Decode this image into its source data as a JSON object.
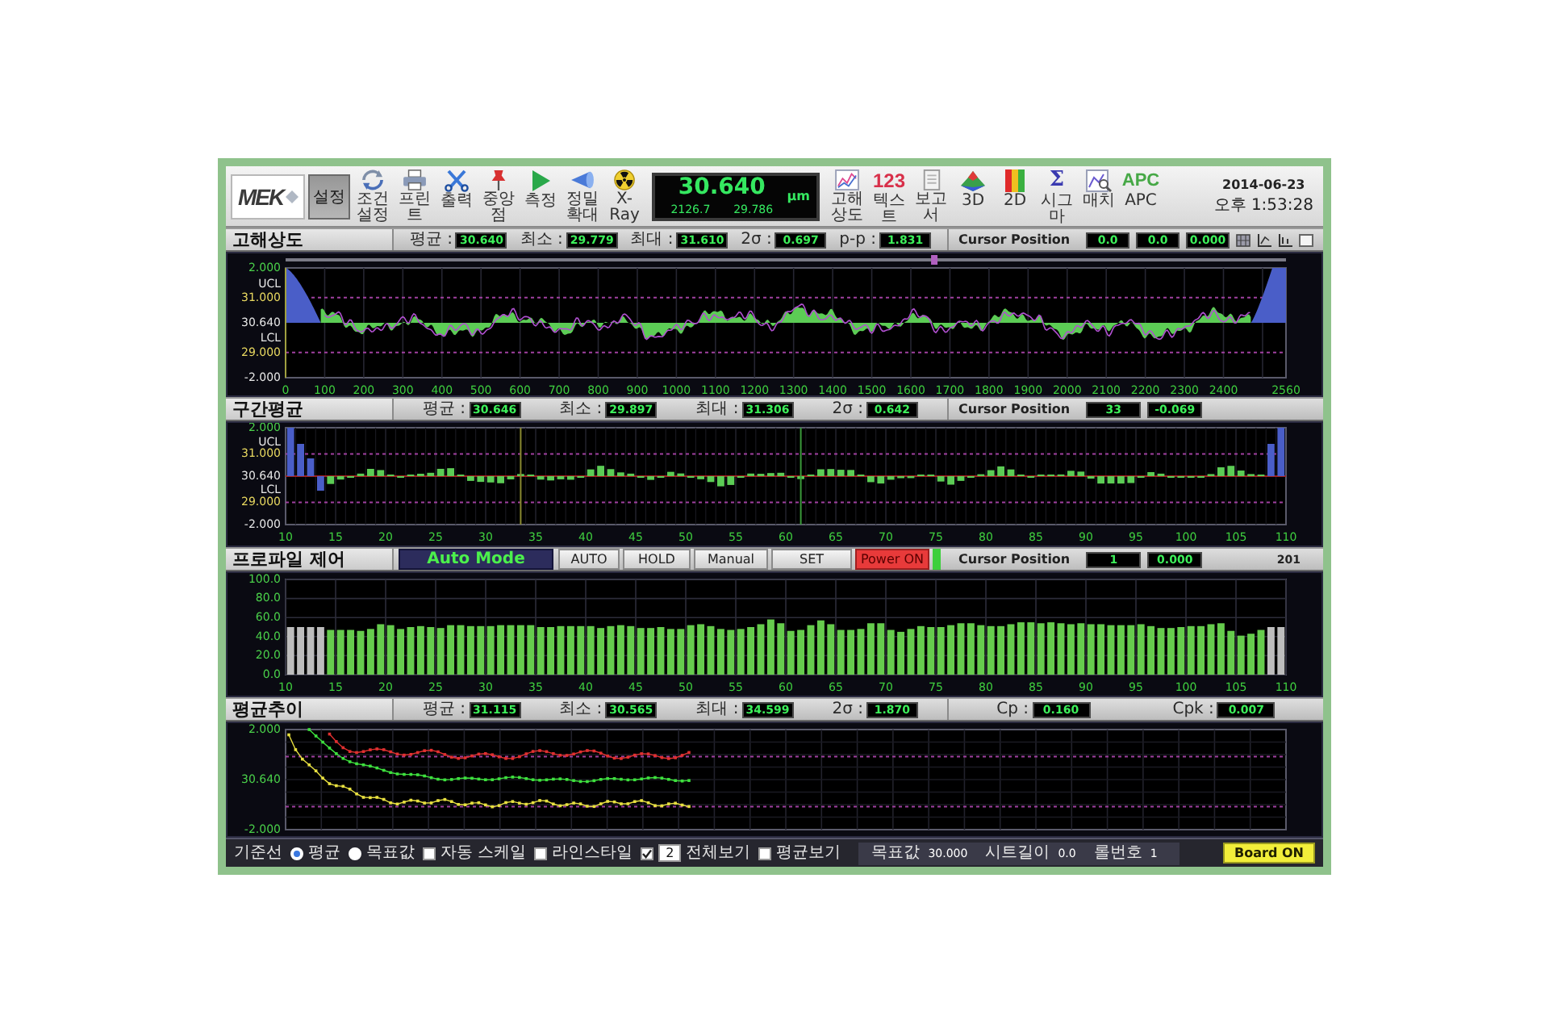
{
  "toolbar": {
    "logo": "MEK",
    "mode_button": {
      "label": "설정",
      "selected": true
    },
    "tools_left": [
      {
        "kind": "cycle",
        "label": "조건설정"
      },
      {
        "kind": "printer",
        "label": "프린트"
      },
      {
        "kind": "tool",
        "label": "출력"
      },
      {
        "kind": "pin",
        "label": "중앙점"
      },
      {
        "kind": "play",
        "label": "측정"
      },
      {
        "kind": "cone",
        "label": "정밀확대"
      },
      {
        "kind": "radiation",
        "label": "X-Ray"
      }
    ],
    "readout": {
      "value": "30.640",
      "sub_values": [
        "2126.7",
        "29.786"
      ],
      "unit": "μm"
    },
    "tools_right": [
      {
        "kind": "line_chart",
        "label": "고해상도"
      },
      {
        "kind": "digits",
        "symbol": "123",
        "label": "텍스트"
      },
      {
        "kind": "document",
        "label": "보고서"
      },
      {
        "kind": "surface",
        "label": "3D"
      },
      {
        "kind": "heatmap",
        "label": "2D"
      },
      {
        "kind": "sigma",
        "symbol": "Σ",
        "label": "시그마"
      },
      {
        "kind": "chart_search",
        "label": "매치"
      },
      {
        "kind": "apc",
        "symbol": "APC",
        "label": "APC"
      }
    ],
    "date": "2014-06-23",
    "time": "오후 1:53:28"
  },
  "resolution_panel": {
    "title": "고해상도",
    "stats": [
      {
        "label": "평균 :",
        "value": "30.640"
      },
      {
        "label": "최소 :",
        "value": "29.779"
      },
      {
        "label": "최대 :",
        "value": "31.610"
      },
      {
        "label": "2σ :",
        "value": "0.697"
      },
      {
        "label": "p-p :",
        "value": "1.831"
      }
    ],
    "cursor": {
      "label": "Cursor Position",
      "values": [
        "0.0",
        "0.0",
        "0.000"
      ]
    },
    "view_option": {
      "checked": false
    },
    "chart": {
      "y_labels": [
        "2.000",
        "UCL",
        "31.000",
        "30.640",
        "LCL",
        "29.000",
        "-2.000"
      ],
      "x_labels": [
        "0",
        "100",
        "200",
        "300",
        "400",
        "500",
        "600",
        "700",
        "800",
        "900",
        "1000",
        "1100",
        "1200",
        "1300",
        "1400",
        "1500",
        "1600",
        "1700",
        "1800",
        "1900",
        "2000",
        "2100",
        "2200",
        "2300",
        "2400",
        "2560"
      ]
    }
  },
  "segment_panel": {
    "title": "구간평균",
    "stats": [
      {
        "label": "평균 :",
        "value": "30.646"
      },
      {
        "label": "최소 :",
        "value": "29.897"
      },
      {
        "label": "최대 :",
        "value": "31.306"
      },
      {
        "label": "2σ :",
        "value": "0.642"
      }
    ],
    "cursor": {
      "label": "Cursor Position",
      "values": [
        "33",
        "-0.069"
      ]
    },
    "chart": {
      "y_labels": [
        "2.000",
        "UCL",
        "31.000",
        "30.640",
        "LCL",
        "29.000",
        "-2.000"
      ],
      "x_labels": [
        "10",
        "15",
        "20",
        "25",
        "30",
        "35",
        "40",
        "45",
        "50",
        "55",
        "60",
        "65",
        "70",
        "75",
        "80",
        "85",
        "90",
        "95",
        "100",
        "105",
        "110"
      ]
    }
  },
  "profile_panel": {
    "title": "프로파일 제어",
    "mode_label": "Auto Mode",
    "buttons": [
      {
        "label": "AUTO",
        "kind": "plain"
      },
      {
        "label": "HOLD",
        "kind": "plain"
      },
      {
        "label": "Manual",
        "kind": "plain"
      },
      {
        "label": "SET",
        "kind": "plain"
      },
      {
        "label": "Power ON",
        "kind": "alarm"
      }
    ],
    "power_light": {
      "on": true
    },
    "cursor": {
      "label": "Cursor Position",
      "values": [
        "1",
        "0.000"
      ],
      "count": "201"
    },
    "chart_data": {
      "type": "bar",
      "x": [
        10,
        11,
        12,
        13,
        14,
        15,
        16,
        17,
        18,
        19,
        20,
        21,
        22,
        23,
        24,
        25,
        26,
        27,
        28,
        29,
        30,
        31,
        32,
        33,
        34,
        35,
        36,
        37,
        38,
        39,
        40,
        41,
        42,
        43,
        44,
        45,
        46,
        47,
        48,
        49,
        50,
        51,
        52,
        53,
        54,
        55,
        56,
        57,
        58,
        59,
        60,
        61,
        62,
        63,
        64,
        65,
        66,
        67,
        68,
        69,
        70,
        71,
        72,
        73,
        74,
        75,
        76,
        77,
        78,
        79,
        80,
        81,
        82,
        83,
        84,
        85,
        86,
        87,
        88,
        89,
        90,
        91,
        92,
        93,
        94,
        95,
        96,
        97,
        98,
        99,
        100,
        101,
        102,
        103,
        104,
        105,
        106,
        107,
        108,
        109
      ],
      "xlim": [
        10,
        110
      ],
      "ylim": [
        0,
        100
      ],
      "xticks": [
        10,
        15,
        20,
        25,
        30,
        35,
        40,
        45,
        50,
        55,
        60,
        65,
        70,
        75,
        80,
        85,
        90,
        95,
        100,
        105,
        110
      ],
      "yticks": [
        {
          "value": 0,
          "label": "0.0"
        },
        {
          "value": 20,
          "label": "20.0"
        },
        {
          "value": 40,
          "label": "40.0"
        },
        {
          "value": 60,
          "label": "60.0"
        },
        {
          "value": 80,
          "label": "80.0"
        },
        {
          "value": 100,
          "label": "100.0"
        }
      ],
      "grid": true,
      "stacked": true,
      "series": [
        {
          "color": "#bdbdbd",
          "values": [
            50,
            50,
            50,
            50,
            null,
            null,
            null,
            null,
            null,
            null,
            null,
            null,
            null,
            null,
            null,
            null,
            null,
            null,
            null,
            null,
            null,
            null,
            null,
            null,
            null,
            null,
            null,
            null,
            null,
            null,
            null,
            null,
            null,
            null,
            null,
            null,
            null,
            null,
            null,
            null,
            null,
            null,
            null,
            null,
            null,
            null,
            null,
            null,
            null,
            null,
            null,
            null,
            null,
            null,
            null,
            null,
            null,
            null,
            null,
            null,
            null,
            null,
            null,
            null,
            null,
            null,
            null,
            null,
            null,
            null,
            null,
            null,
            null,
            null,
            null,
            null,
            null,
            null,
            null,
            null,
            null,
            null,
            null,
            null,
            null,
            null,
            null,
            null,
            null,
            null,
            null,
            null,
            null,
            null,
            null,
            null,
            null,
            null,
            50,
            50
          ]
        },
        {
          "color": "#66cc4d",
          "values": [
            null,
            null,
            null,
            null,
            47,
            47,
            47,
            46,
            48,
            53,
            52,
            48,
            50,
            51,
            50,
            49,
            52,
            52,
            51,
            51,
            51,
            52,
            52,
            52,
            52,
            50,
            50,
            51,
            51,
            51,
            51,
            49,
            51,
            52,
            51,
            49,
            49,
            50,
            48,
            48,
            52,
            53,
            51,
            48,
            47,
            48,
            50,
            53,
            58,
            54,
            46,
            47,
            52,
            57,
            53,
            47,
            47,
            48,
            54,
            54,
            47,
            45,
            48,
            51,
            50,
            50,
            52,
            54,
            54,
            52,
            51,
            51,
            53,
            55,
            55,
            54,
            55,
            54,
            53,
            54,
            53,
            53,
            52,
            52,
            52,
            53,
            51,
            49,
            49,
            50,
            51,
            51,
            53,
            54,
            46,
            41,
            43,
            47,
            null,
            null
          ]
        }
      ]
    }
  },
  "trend_panel": {
    "title": "평균추이",
    "stats": [
      {
        "label": "평균 :",
        "value": "31.115"
      },
      {
        "label": "최소 :",
        "value": "30.565"
      },
      {
        "label": "최대 :",
        "value": "34.599"
      },
      {
        "label": "2σ :",
        "value": "1.870"
      }
    ],
    "capability": [
      {
        "label": "Cp :",
        "value": "0.160"
      },
      {
        "label": "Cpk :",
        "value": "0.007"
      }
    ],
    "chart": {
      "y_labels": [
        "2.000",
        "30.640",
        "-2.000"
      ]
    }
  },
  "footer": {
    "baseline_label": "기준선",
    "baseline_options": [
      {
        "label": "평균",
        "selected": true
      },
      {
        "label": "목표값",
        "selected": false
      }
    ],
    "options": [
      {
        "label": "자동 스케일",
        "checked": false
      },
      {
        "label": "라인스타일",
        "checked": false
      },
      {
        "label": "전체보기",
        "checked": true,
        "value": "2"
      },
      {
        "label": "평균보기",
        "checked": false
      }
    ],
    "readings": [
      {
        "label": "목표값",
        "value": "30.000"
      },
      {
        "label": "시트길이",
        "value": "0.0"
      },
      {
        "label": "롤번호",
        "value": "1"
      }
    ],
    "board_button": "Board ON"
  }
}
